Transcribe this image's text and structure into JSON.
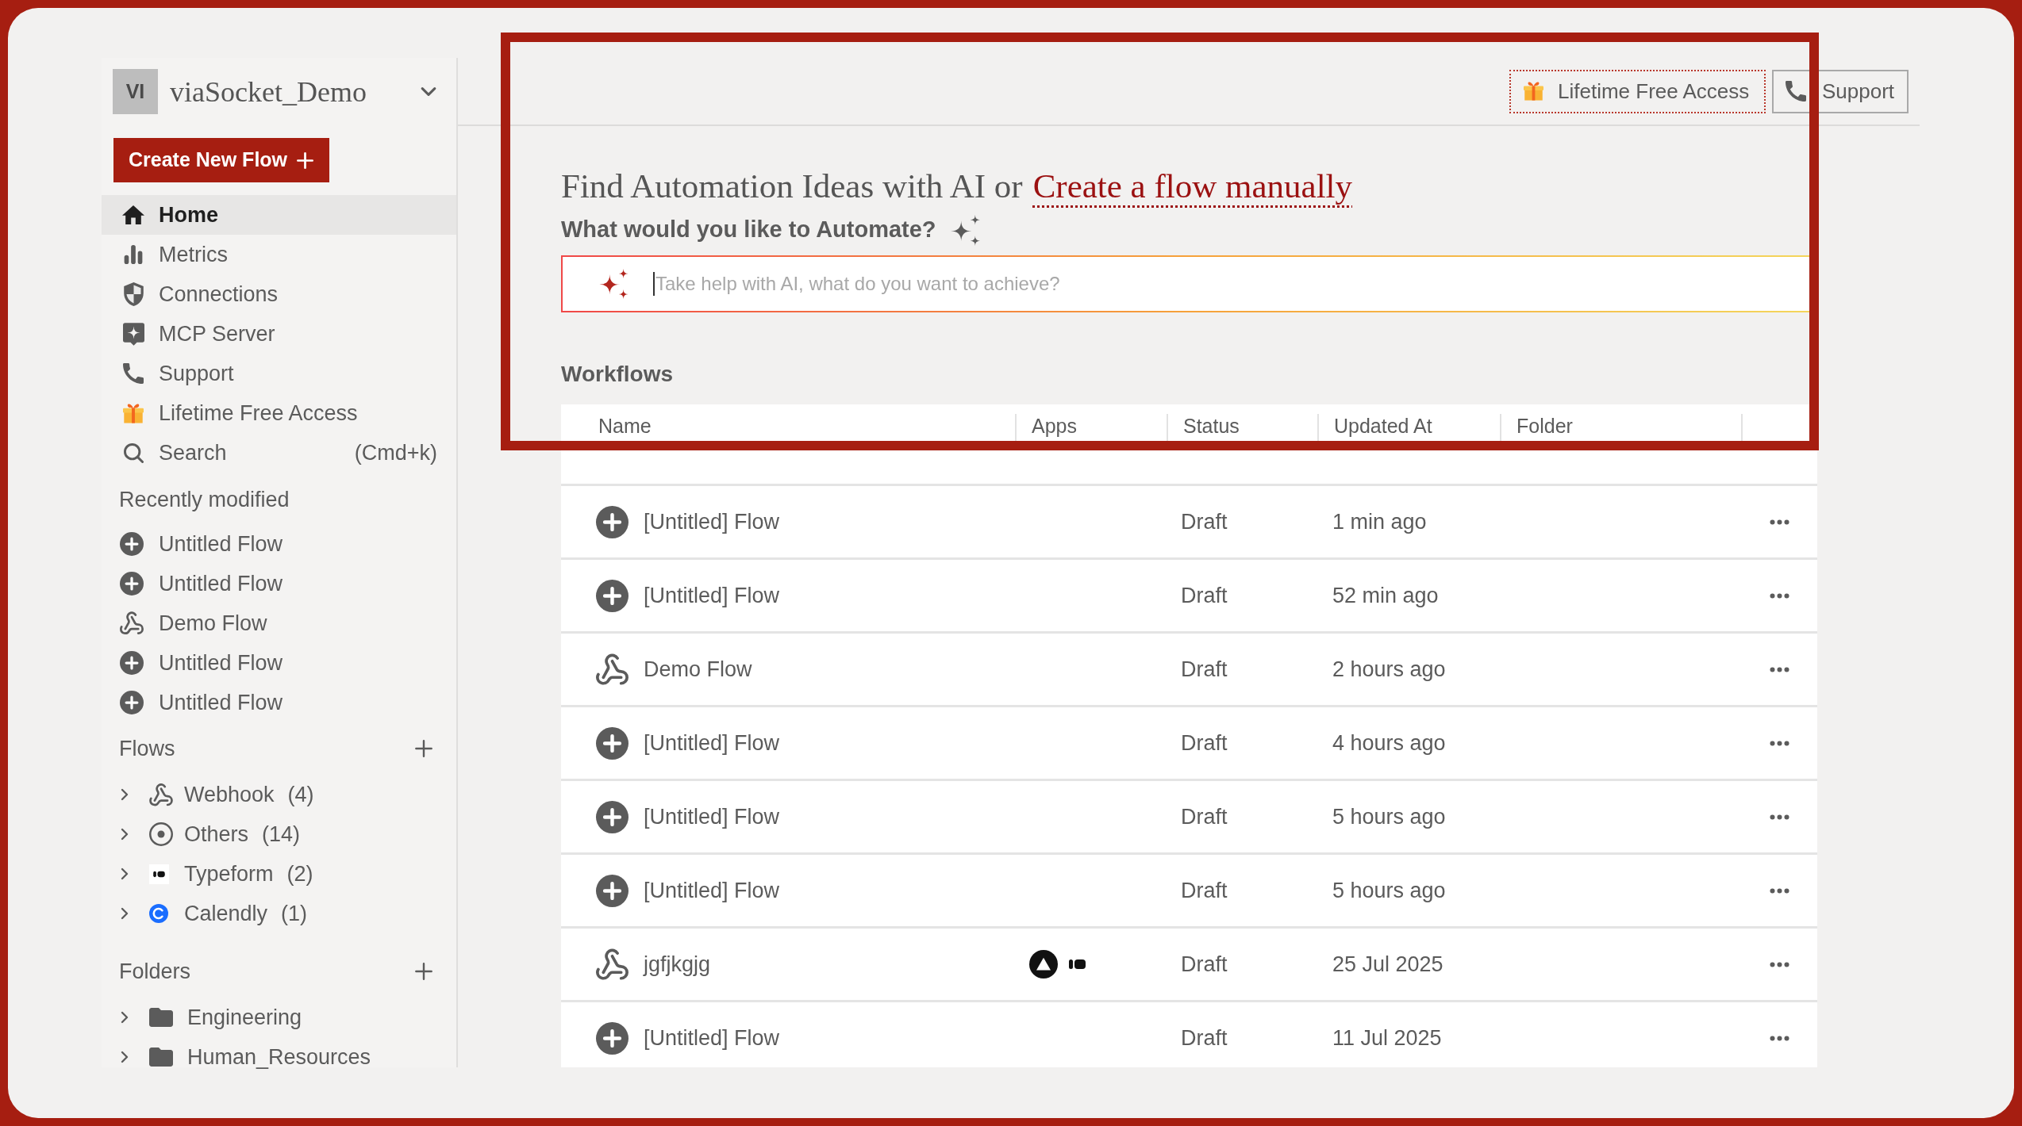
{
  "sidebar": {
    "workspace": {
      "avatar": "VI",
      "name": "viaSocket_Demo"
    },
    "create_button": "Create New Flow",
    "nav": [
      {
        "kind": "home",
        "label": "Home",
        "selected": true
      },
      {
        "kind": "metrics",
        "label": "Metrics",
        "selected": false
      },
      {
        "kind": "connections",
        "label": "Connections",
        "selected": false
      },
      {
        "kind": "mcp",
        "label": "MCP Server",
        "selected": false
      },
      {
        "kind": "support",
        "label": "Support",
        "selected": false
      },
      {
        "kind": "gift",
        "label": "Lifetime Free Access",
        "selected": false
      },
      {
        "kind": "search",
        "label": "Search",
        "shortcut": "(Cmd+k)",
        "selected": false
      }
    ],
    "recently_modified": {
      "title": "Recently modified",
      "items": [
        {
          "kind": "untitled",
          "label": "Untitled Flow"
        },
        {
          "kind": "untitled",
          "label": "Untitled Flow"
        },
        {
          "kind": "webhook",
          "label": "Demo Flow"
        },
        {
          "kind": "untitled",
          "label": "Untitled Flow"
        },
        {
          "kind": "untitled",
          "label": "Untitled Flow"
        }
      ]
    },
    "flows": {
      "title": "Flows",
      "items": [
        {
          "kind": "webhook",
          "label": "Webhook",
          "count": "(4)",
          "expanded": false
        },
        {
          "kind": "others",
          "label": "Others",
          "count": "(14)",
          "expanded": false
        },
        {
          "kind": "typeform",
          "label": "Typeform",
          "count": "(2)",
          "expanded": false
        },
        {
          "kind": "calendly",
          "label": "Calendly",
          "count": "(1)",
          "expanded": false
        }
      ]
    },
    "folders": {
      "title": "Folders",
      "items": [
        {
          "label": "Engineering",
          "expanded": false
        },
        {
          "label": "Human_Resources",
          "expanded": false
        }
      ]
    }
  },
  "header": {
    "buttons": [
      {
        "kind": "promo",
        "label": "Lifetime Free Access"
      },
      {
        "kind": "support",
        "label": "Support"
      }
    ]
  },
  "hero": {
    "title": "Find Automation Ideas with AI or",
    "link": "Create a flow manually",
    "prompt": "What would you like to Automate?",
    "input": {
      "placeholder": "Take help with AI, what do you want to achieve?",
      "focused": true
    }
  },
  "workflows": {
    "title": "Workflows",
    "table": {
      "columns": [
        "Name",
        "Apps",
        "Status",
        "Updated At",
        "Folder"
      ],
      "rows": [
        {
          "kind": "untitled",
          "name": "[Untitled] Flow",
          "status": "Draft",
          "updated_at": "1 min ago"
        },
        {
          "kind": "untitled",
          "name": "[Untitled] Flow",
          "status": "Draft",
          "updated_at": "52 min ago"
        },
        {
          "kind": "webhook",
          "name": "Demo Flow",
          "status": "Draft",
          "updated_at": "2 hours ago"
        },
        {
          "kind": "untitled",
          "name": "[Untitled] Flow",
          "status": "Draft",
          "updated_at": "4 hours ago"
        },
        {
          "kind": "untitled",
          "name": "[Untitled] Flow",
          "status": "Draft",
          "updated_at": "5 hours ago"
        },
        {
          "kind": "untitled",
          "name": "[Untitled] Flow",
          "status": "Draft",
          "updated_at": "5 hours ago"
        },
        {
          "kind": "webhook",
          "name": "jgfjkgjg",
          "apps": [
            {
              "kind": "triangle"
            },
            {
              "kind": "typeform"
            }
          ],
          "status": "Draft",
          "updated_at": "25 Jul 2025"
        },
        {
          "kind": "untitled",
          "name": "[Untitled] Flow",
          "status": "Draft",
          "updated_at": "11 Jul 2025"
        }
      ]
    }
  }
}
